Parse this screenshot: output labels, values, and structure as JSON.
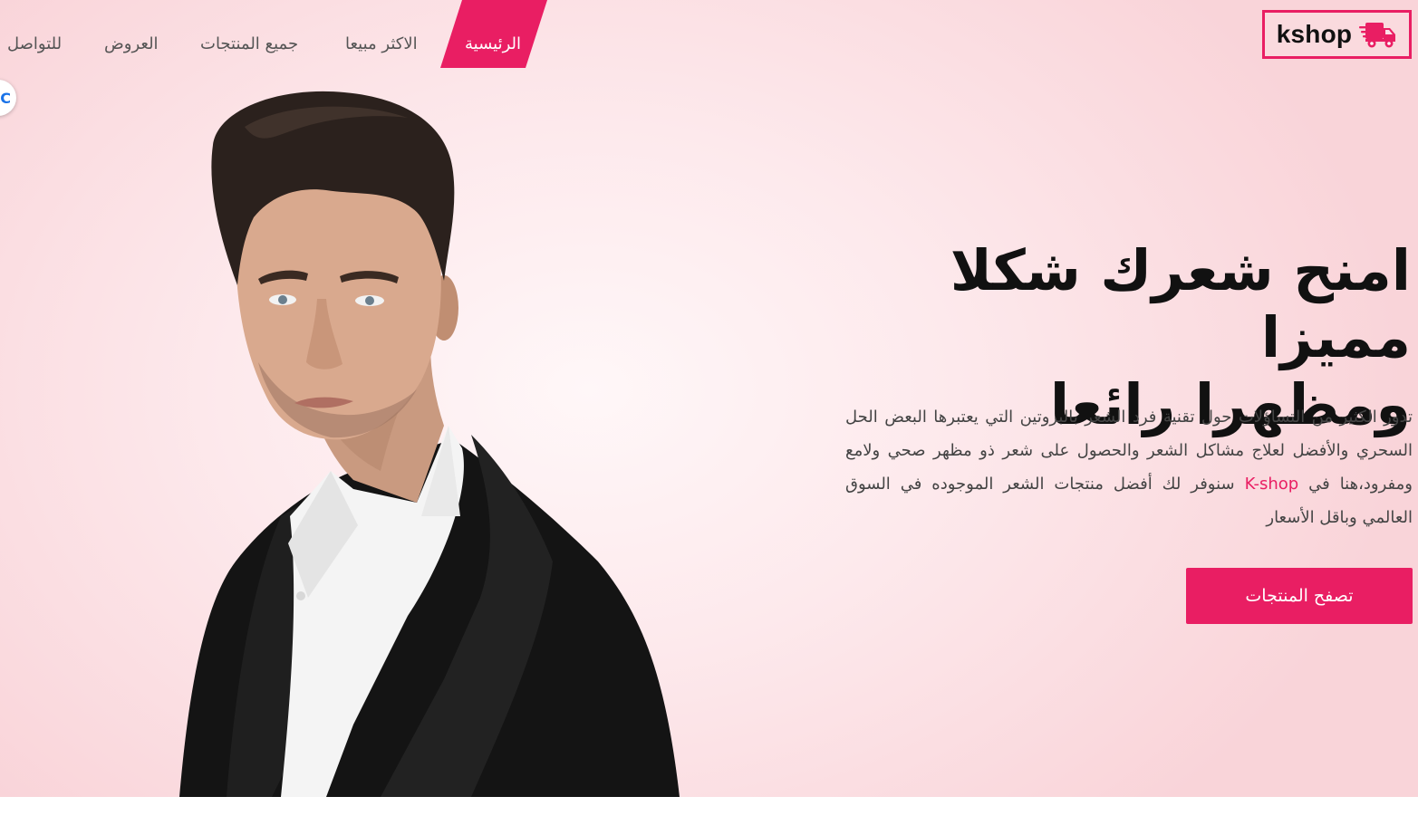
{
  "colors": {
    "accent": "#e91e63",
    "text_dark": "#111111",
    "text_body": "#444444",
    "nav_text": "#555555"
  },
  "logo": {
    "text": "kshop",
    "icon": "delivery-truck-icon"
  },
  "nav": {
    "items": [
      {
        "label": "الرئيسية",
        "active": true
      },
      {
        "label": "الاكثر مبيعا",
        "active": false
      },
      {
        "label": "جميع المنتجات",
        "active": false
      },
      {
        "label": "العروض",
        "active": false
      },
      {
        "label": "للتواصل",
        "active": false
      }
    ]
  },
  "side_widget": {
    "icon": "chat-widget-icon"
  },
  "hero": {
    "headline_line1": "امنح شعرك شكلا مميزا",
    "headline_line2": "ومظهرا رائعا",
    "desc_before": "تدور الكثير من التساؤلات حول تقنية فرد الشعر بالبروتين التي يعتبرها البعض الحل السحري والأفضل لعلاج مشاكل الشعر والحصول على شعر ذو مظهر صحي ولامع ومفرود،هنا في ",
    "desc_brand": "K-shop",
    "desc_after": " سنوفر لك أفضل منتجات الشعر الموجوده في السوق العالمي وباقل الأسعار",
    "cta_label": "تصفح المنتجات",
    "image": "man-portrait-image"
  }
}
